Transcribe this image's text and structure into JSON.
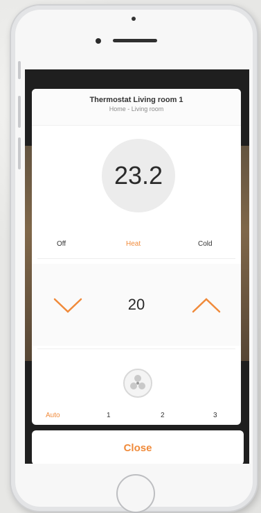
{
  "thermostat": {
    "title": "Thermostat Living room 1",
    "subtitle": "Home - Living room",
    "current_temp": "23.2",
    "setpoint": "20",
    "modes": [
      {
        "label": "Off",
        "active": false
      },
      {
        "label": "Heat",
        "active": true
      },
      {
        "label": "Cold",
        "active": false
      }
    ],
    "fan_speeds": [
      {
        "label": "Auto",
        "active": true
      },
      {
        "label": "1",
        "active": false
      },
      {
        "label": "2",
        "active": false
      },
      {
        "label": "3",
        "active": false
      }
    ],
    "close_label": "Close"
  },
  "colors": {
    "accent": "#f08a3a",
    "text": "#333333"
  }
}
